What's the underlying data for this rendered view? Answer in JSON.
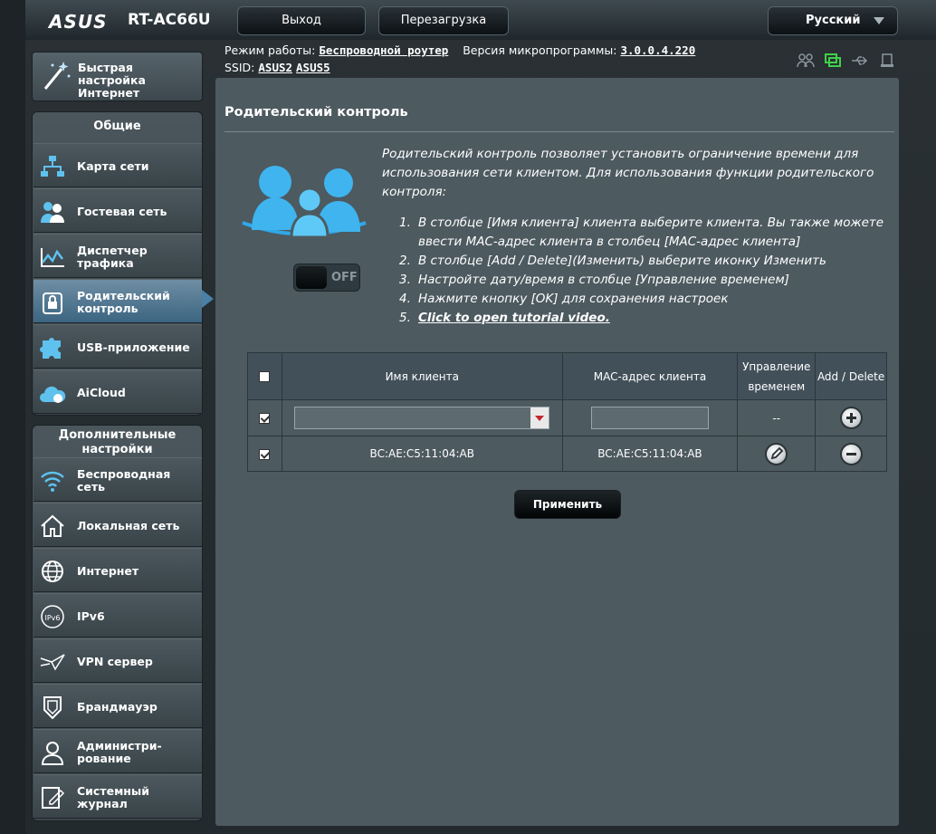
{
  "header": {
    "brand": "ASUS",
    "model": "RT-AC66U",
    "logout": "Выход",
    "reboot": "Перезагрузка",
    "language": "Русский"
  },
  "status": {
    "mode_label": "Режим работы:",
    "mode_value": "Беспроводной роутер",
    "fw_label": "Версия микропрограммы:",
    "fw_value": "3.0.0.4.220",
    "ssid_label": "SSID:",
    "ssid1": "ASUS2",
    "ssid2": "ASUS5"
  },
  "sidebar": {
    "quick": "Быстрая настройка Интернет",
    "general_head": "Общие",
    "general": [
      {
        "label": "Карта сети",
        "icon": "network-map-icon"
      },
      {
        "label": "Гостевая сеть",
        "icon": "guest-network-icon"
      },
      {
        "label": "Диспетчер трафика",
        "icon": "traffic-manager-icon"
      },
      {
        "label": "Родительский контроль",
        "icon": "parental-control-icon"
      },
      {
        "label": "USB-приложение",
        "icon": "usb-app-icon"
      },
      {
        "label": "AiCloud",
        "icon": "aicloud-icon"
      }
    ],
    "advanced_head": "Дополнительные настройки",
    "advanced": [
      {
        "label": "Беспроводная сеть",
        "icon": "wireless-icon"
      },
      {
        "label": "Локальная сеть",
        "icon": "lan-icon"
      },
      {
        "label": "Интернет",
        "icon": "internet-icon"
      },
      {
        "label": "IPv6",
        "icon": "ipv6-icon"
      },
      {
        "label": "VPN сервер",
        "icon": "vpn-icon"
      },
      {
        "label": "Брандмауэр",
        "icon": "firewall-icon"
      },
      {
        "label": "Администри-рование",
        "icon": "admin-icon"
      },
      {
        "label": "Системный журнал",
        "icon": "syslog-icon"
      }
    ]
  },
  "main": {
    "title": "Родительский контроль",
    "description": "Родительский контроль позволяет установить ограничение времени для использования сети клиентом. Для использования функции родительского контроля:",
    "steps": [
      "В столбце [Имя клиента] клиента выберите клиента. Вы также можете ввести MAC-адрес клиента в столбец [MAC-адрес клиента]",
      "В столбце [Add / Delete](Изменить) выберите иконку Изменить",
      "Настройте дату/время в столбце [Управление временем]",
      "Нажмите кнопку [OK] для сохранения настроек",
      "Click to open tutorial video."
    ],
    "toggle": "OFF",
    "table": {
      "headers": [
        "Имя клиента",
        "MAC-адрес клиента",
        "Управление временем",
        "Add / Delete"
      ],
      "new_row_time": "--",
      "rows": [
        {
          "name": "BC:AE:C5:11:04:AB",
          "mac": "BC:AE:C5:11:04:AB"
        }
      ]
    },
    "apply": "Применить"
  }
}
